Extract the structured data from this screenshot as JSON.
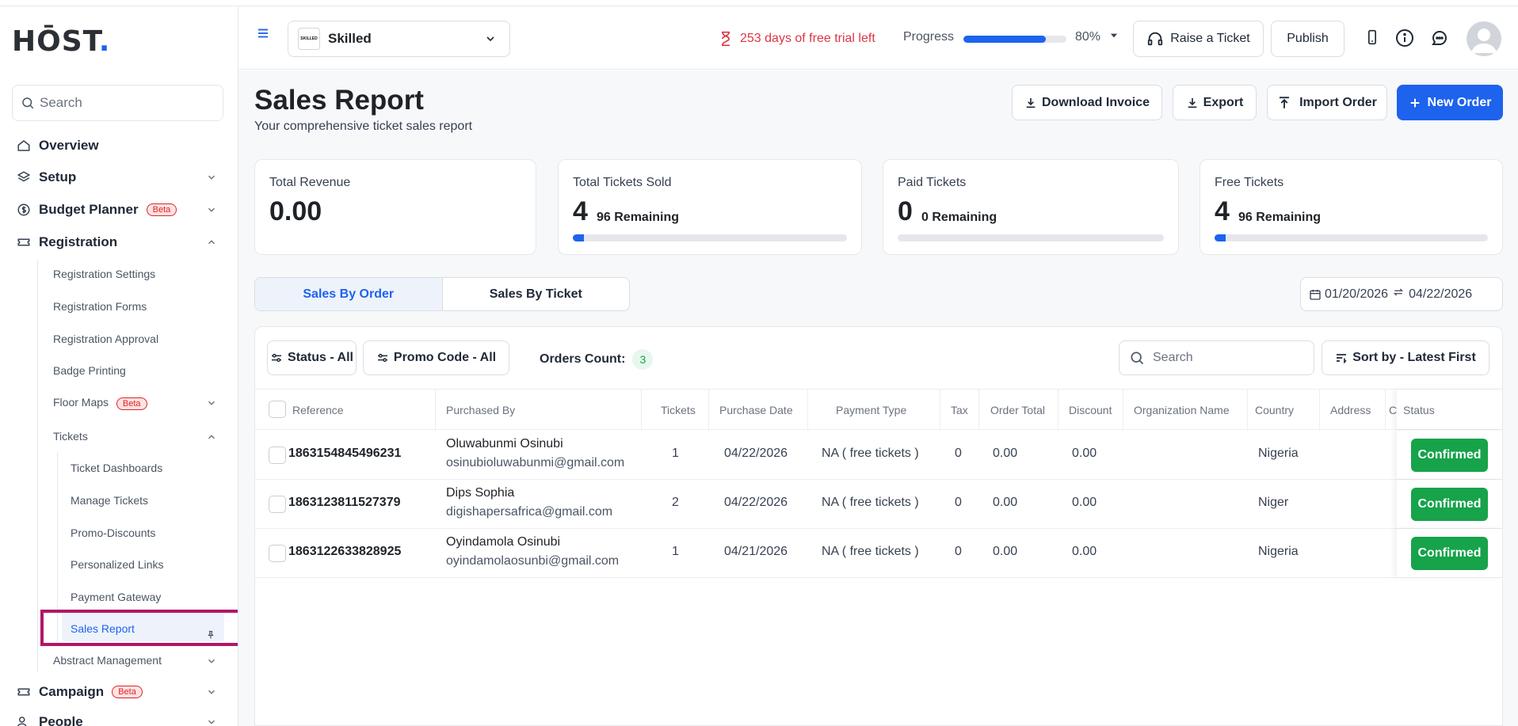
{
  "brand": {
    "logo_text": "HŌST",
    "logo_dot": "."
  },
  "sidebar": {
    "search_placeholder": "Search",
    "items": {
      "overview": "Overview",
      "setup": "Setup",
      "budget_planner": "Budget Planner",
      "budget_badge": "Beta",
      "registration": "Registration",
      "registration_settings": "Registration Settings",
      "registration_forms": "Registration Forms",
      "registration_approval": "Registration Approval",
      "badge_printing": "Badge Printing",
      "floor_maps": "Floor Maps",
      "floor_badge": "Beta",
      "tickets": "Tickets",
      "ticket_dashboards": "Ticket Dashboards",
      "manage_tickets": "Manage Tickets",
      "promo_discounts": "Promo-Discounts",
      "personalized_links": "Personalized Links",
      "payment_gateway": "Payment Gateway",
      "sales_report": "Sales Report",
      "abstract_management": "Abstract Management",
      "campaign": "Campaign",
      "campaign_badge": "Beta",
      "people": "People"
    }
  },
  "topbar": {
    "event_name": "Skilled",
    "event_logo_text": "SKILLED",
    "trial_text": "253 days of free trial left",
    "progress_label": "Progress",
    "progress_value": 0.8,
    "progress_text": "80%",
    "raise_ticket": "Raise a Ticket",
    "publish": "Publish"
  },
  "page": {
    "title": "Sales Report",
    "subtitle": "Your comprehensive ticket sales report",
    "actions": {
      "download_invoice": "Download Invoice",
      "export": "Export",
      "import_order": "Import Order",
      "new_order": "New Order"
    }
  },
  "stats": {
    "total_revenue": {
      "label": "Total Revenue",
      "value": "0.00"
    },
    "total_sold": {
      "label": "Total Tickets Sold",
      "value": "4",
      "remaining": "96 Remaining",
      "fraction": 0.04
    },
    "paid": {
      "label": "Paid Tickets",
      "value": "0",
      "remaining": "0 Remaining",
      "fraction": 0
    },
    "free": {
      "label": "Free Tickets",
      "value": "4",
      "remaining": "96 Remaining",
      "fraction": 0.04
    }
  },
  "tabs": {
    "by_order": "Sales By Order",
    "by_ticket": "Sales By Ticket"
  },
  "date_range": {
    "from": "01/20/2026",
    "to": "04/22/2026"
  },
  "filters": {
    "status": "Status - All",
    "promo": "Promo Code - All",
    "orders_count_label": "Orders Count:",
    "orders_count": "3",
    "search_placeholder": "Search",
    "sort": "Sort by - Latest First"
  },
  "table": {
    "headers": {
      "reference": "Reference",
      "purchased_by": "Purchased By",
      "tickets": "Tickets",
      "purchase_date": "Purchase Date",
      "payment_type": "Payment Type",
      "tax": "Tax",
      "order_total": "Order Total",
      "discount": "Discount",
      "organization": "Organization Name",
      "country": "Country",
      "address": "Address",
      "c": "C",
      "status": "Status"
    },
    "rows": [
      {
        "reference": "1863154845496231",
        "name": "Oluwabunmi Osinubi",
        "email": "osinubioluwabunmi@gmail.com",
        "tickets": "1",
        "date": "04/22/2026",
        "payment": "NA ( free tickets )",
        "tax": "0",
        "total": "0.00",
        "discount": "0.00",
        "country": "Nigeria",
        "status": "Confirmed"
      },
      {
        "reference": "1863123811527379",
        "name": "Dips Sophia",
        "email": "digishapersafrica@gmail.com",
        "tickets": "2",
        "date": "04/22/2026",
        "payment": "NA ( free tickets )",
        "tax": "0",
        "total": "0.00",
        "discount": "0.00",
        "country": "Niger",
        "status": "Confirmed"
      },
      {
        "reference": "1863122633828925",
        "name": "Oyindamola Osinubi",
        "email": "oyindamolaosunbi@gmail.com",
        "tickets": "1",
        "date": "04/21/2026",
        "payment": "NA ( free tickets )",
        "tax": "0",
        "total": "0.00",
        "discount": "0.00",
        "country": "Nigeria",
        "status": "Confirmed"
      }
    ]
  }
}
